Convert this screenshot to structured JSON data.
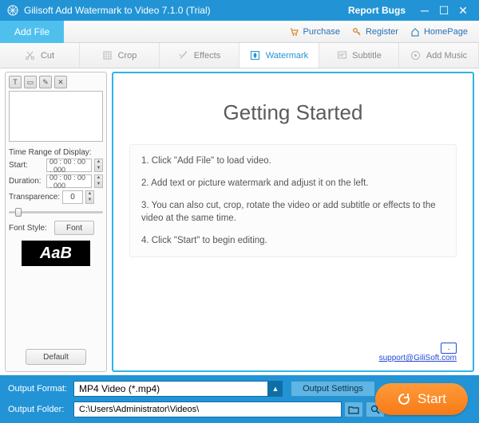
{
  "window": {
    "title": "Gilisoft Add Watermark to Video 7.1.0 (Trial)",
    "report_bugs": "Report Bugs"
  },
  "secondbar": {
    "add_file": "Add File",
    "purchase": "Purchase",
    "register": "Register",
    "homepage": "HomePage"
  },
  "tabs": {
    "cut": "Cut",
    "crop": "Crop",
    "effects": "Effects",
    "watermark": "Watermark",
    "subtitle": "Subtitle",
    "addmusic": "Add Music"
  },
  "left": {
    "time_range_label": "Time Range of Display:",
    "start_label": "Start:",
    "start_value": "00 : 00 : 00 . 000",
    "duration_label": "Duration:",
    "duration_value": "00 : 00 : 00 . 000",
    "transparence_label": "Transparence:",
    "transparence_value": "0",
    "fontstyle_label": "Font Style:",
    "font_button": "Font",
    "font_sample": "AaB",
    "default_button": "Default"
  },
  "main": {
    "title": "Getting Started",
    "step1": "1. Click \"Add File\" to load video.",
    "step2": "2. Add text or picture watermark and adjust it on the left.",
    "step3": "3. You can also cut, crop, rotate the video or add subtitle or effects to the video at the same time.",
    "step4": "4. Click \"Start\" to begin editing.",
    "support_email": "support@GiliSoft.com"
  },
  "bottom": {
    "output_format_label": "Output Format:",
    "output_format_value": "MP4 Video (*.mp4)",
    "output_settings": "Output Settings",
    "output_folder_label": "Output Folder:",
    "output_folder_value": "C:\\Users\\Administrator\\Videos\\",
    "start": "Start"
  }
}
